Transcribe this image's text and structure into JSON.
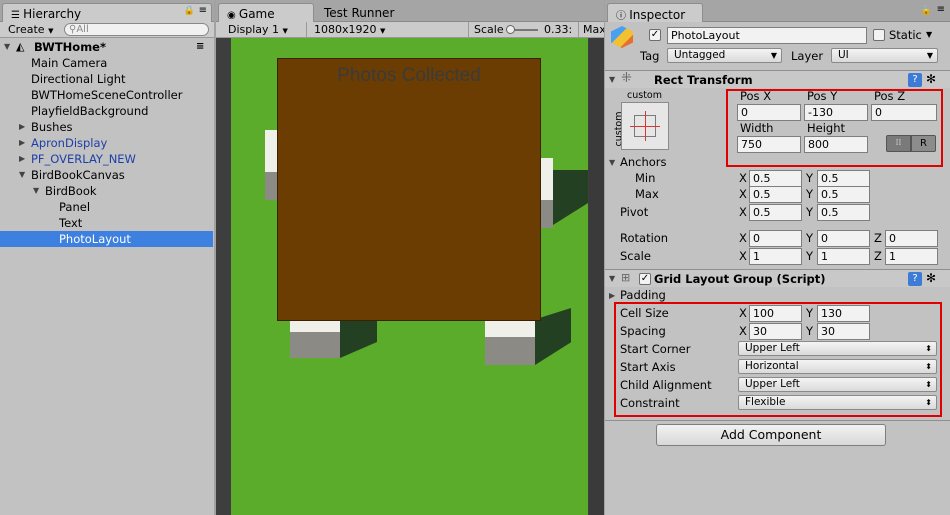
{
  "hierarchy": {
    "tab": "Hierarchy",
    "create": "Create",
    "search_placeholder": "All",
    "scene": "BWTHome*",
    "items": [
      {
        "label": "Main Camera",
        "indent": 1,
        "arrow": false
      },
      {
        "label": "Directional Light",
        "indent": 1,
        "arrow": false
      },
      {
        "label": "BWTHomeSceneController",
        "indent": 1,
        "arrow": false
      },
      {
        "label": "PlayfieldBackground",
        "indent": 1,
        "arrow": false
      },
      {
        "label": "Bushes",
        "indent": 1,
        "arrow": "right"
      },
      {
        "label": "ApronDisplay",
        "indent": 1,
        "arrow": "right",
        "prefab": true
      },
      {
        "label": "PF_OVERLAY_NEW",
        "indent": 1,
        "arrow": "right",
        "prefab": true
      },
      {
        "label": "BirdBookCanvas",
        "indent": 1,
        "arrow": "down"
      },
      {
        "label": "BirdBook",
        "indent": 2,
        "arrow": "down"
      },
      {
        "label": "Panel",
        "indent": 3,
        "arrow": false
      },
      {
        "label": "Text",
        "indent": 3,
        "arrow": false
      },
      {
        "label": "PhotoLayout",
        "indent": 3,
        "arrow": false,
        "selected": true
      }
    ]
  },
  "game": {
    "tab": "Game",
    "tab2": "Test Runner",
    "display": "Display 1",
    "resolution": "1080x1920",
    "scale_label": "Scale",
    "scale_value": "0.33:",
    "max_label": "Max",
    "panel_title": "Photos Collected"
  },
  "inspector": {
    "tab": "Inspector",
    "object_name": "PhotoLayout",
    "static_label": "Static",
    "tag_label": "Tag",
    "tag_value": "Untagged",
    "layer_label": "Layer",
    "layer_value": "UI",
    "rect_transform": {
      "title": "Rect Transform",
      "anchor_preset": "custom",
      "anchor_preset_side": "custom",
      "pos_x_label": "Pos X",
      "pos_x": "0",
      "pos_y_label": "Pos Y",
      "pos_y": "-130",
      "pos_z_label": "Pos Z",
      "pos_z": "0",
      "width_label": "Width",
      "width": "750",
      "height_label": "Height",
      "height": "800",
      "r_button": "R",
      "anchors_label": "Anchors",
      "min_label": "Min",
      "min_x": "0.5",
      "min_y": "0.5",
      "max_label": "Max",
      "max_x": "0.5",
      "max_y": "0.5",
      "pivot_label": "Pivot",
      "pivot_x": "0.5",
      "pivot_y": "0.5",
      "rotation_label": "Rotation",
      "rot_x": "0",
      "rot_y": "0",
      "rot_z": "0",
      "scale_label": "Scale",
      "scale_x": "1",
      "scale_y": "1",
      "scale_z": "1",
      "x": "X",
      "y": "Y",
      "z": "Z"
    },
    "grid_layout": {
      "title": "Grid Layout Group (Script)",
      "padding_label": "Padding",
      "cell_size_label": "Cell Size",
      "cell_x": "100",
      "cell_y": "130",
      "spacing_label": "Spacing",
      "spacing_x": "30",
      "spacing_y": "30",
      "start_corner_label": "Start Corner",
      "start_corner": "Upper Left",
      "start_axis_label": "Start Axis",
      "start_axis": "Horizontal",
      "child_alignment_label": "Child Alignment",
      "child_alignment": "Upper Left",
      "constraint_label": "Constraint",
      "constraint": "Flexible"
    },
    "add_component": "Add Component"
  },
  "colors": {
    "selection": "#3d80df",
    "highlight": "#e00000",
    "grass": "#5aac2a",
    "brown_panel": "#6b3d02",
    "prefab_text": "#1d3fa6"
  }
}
